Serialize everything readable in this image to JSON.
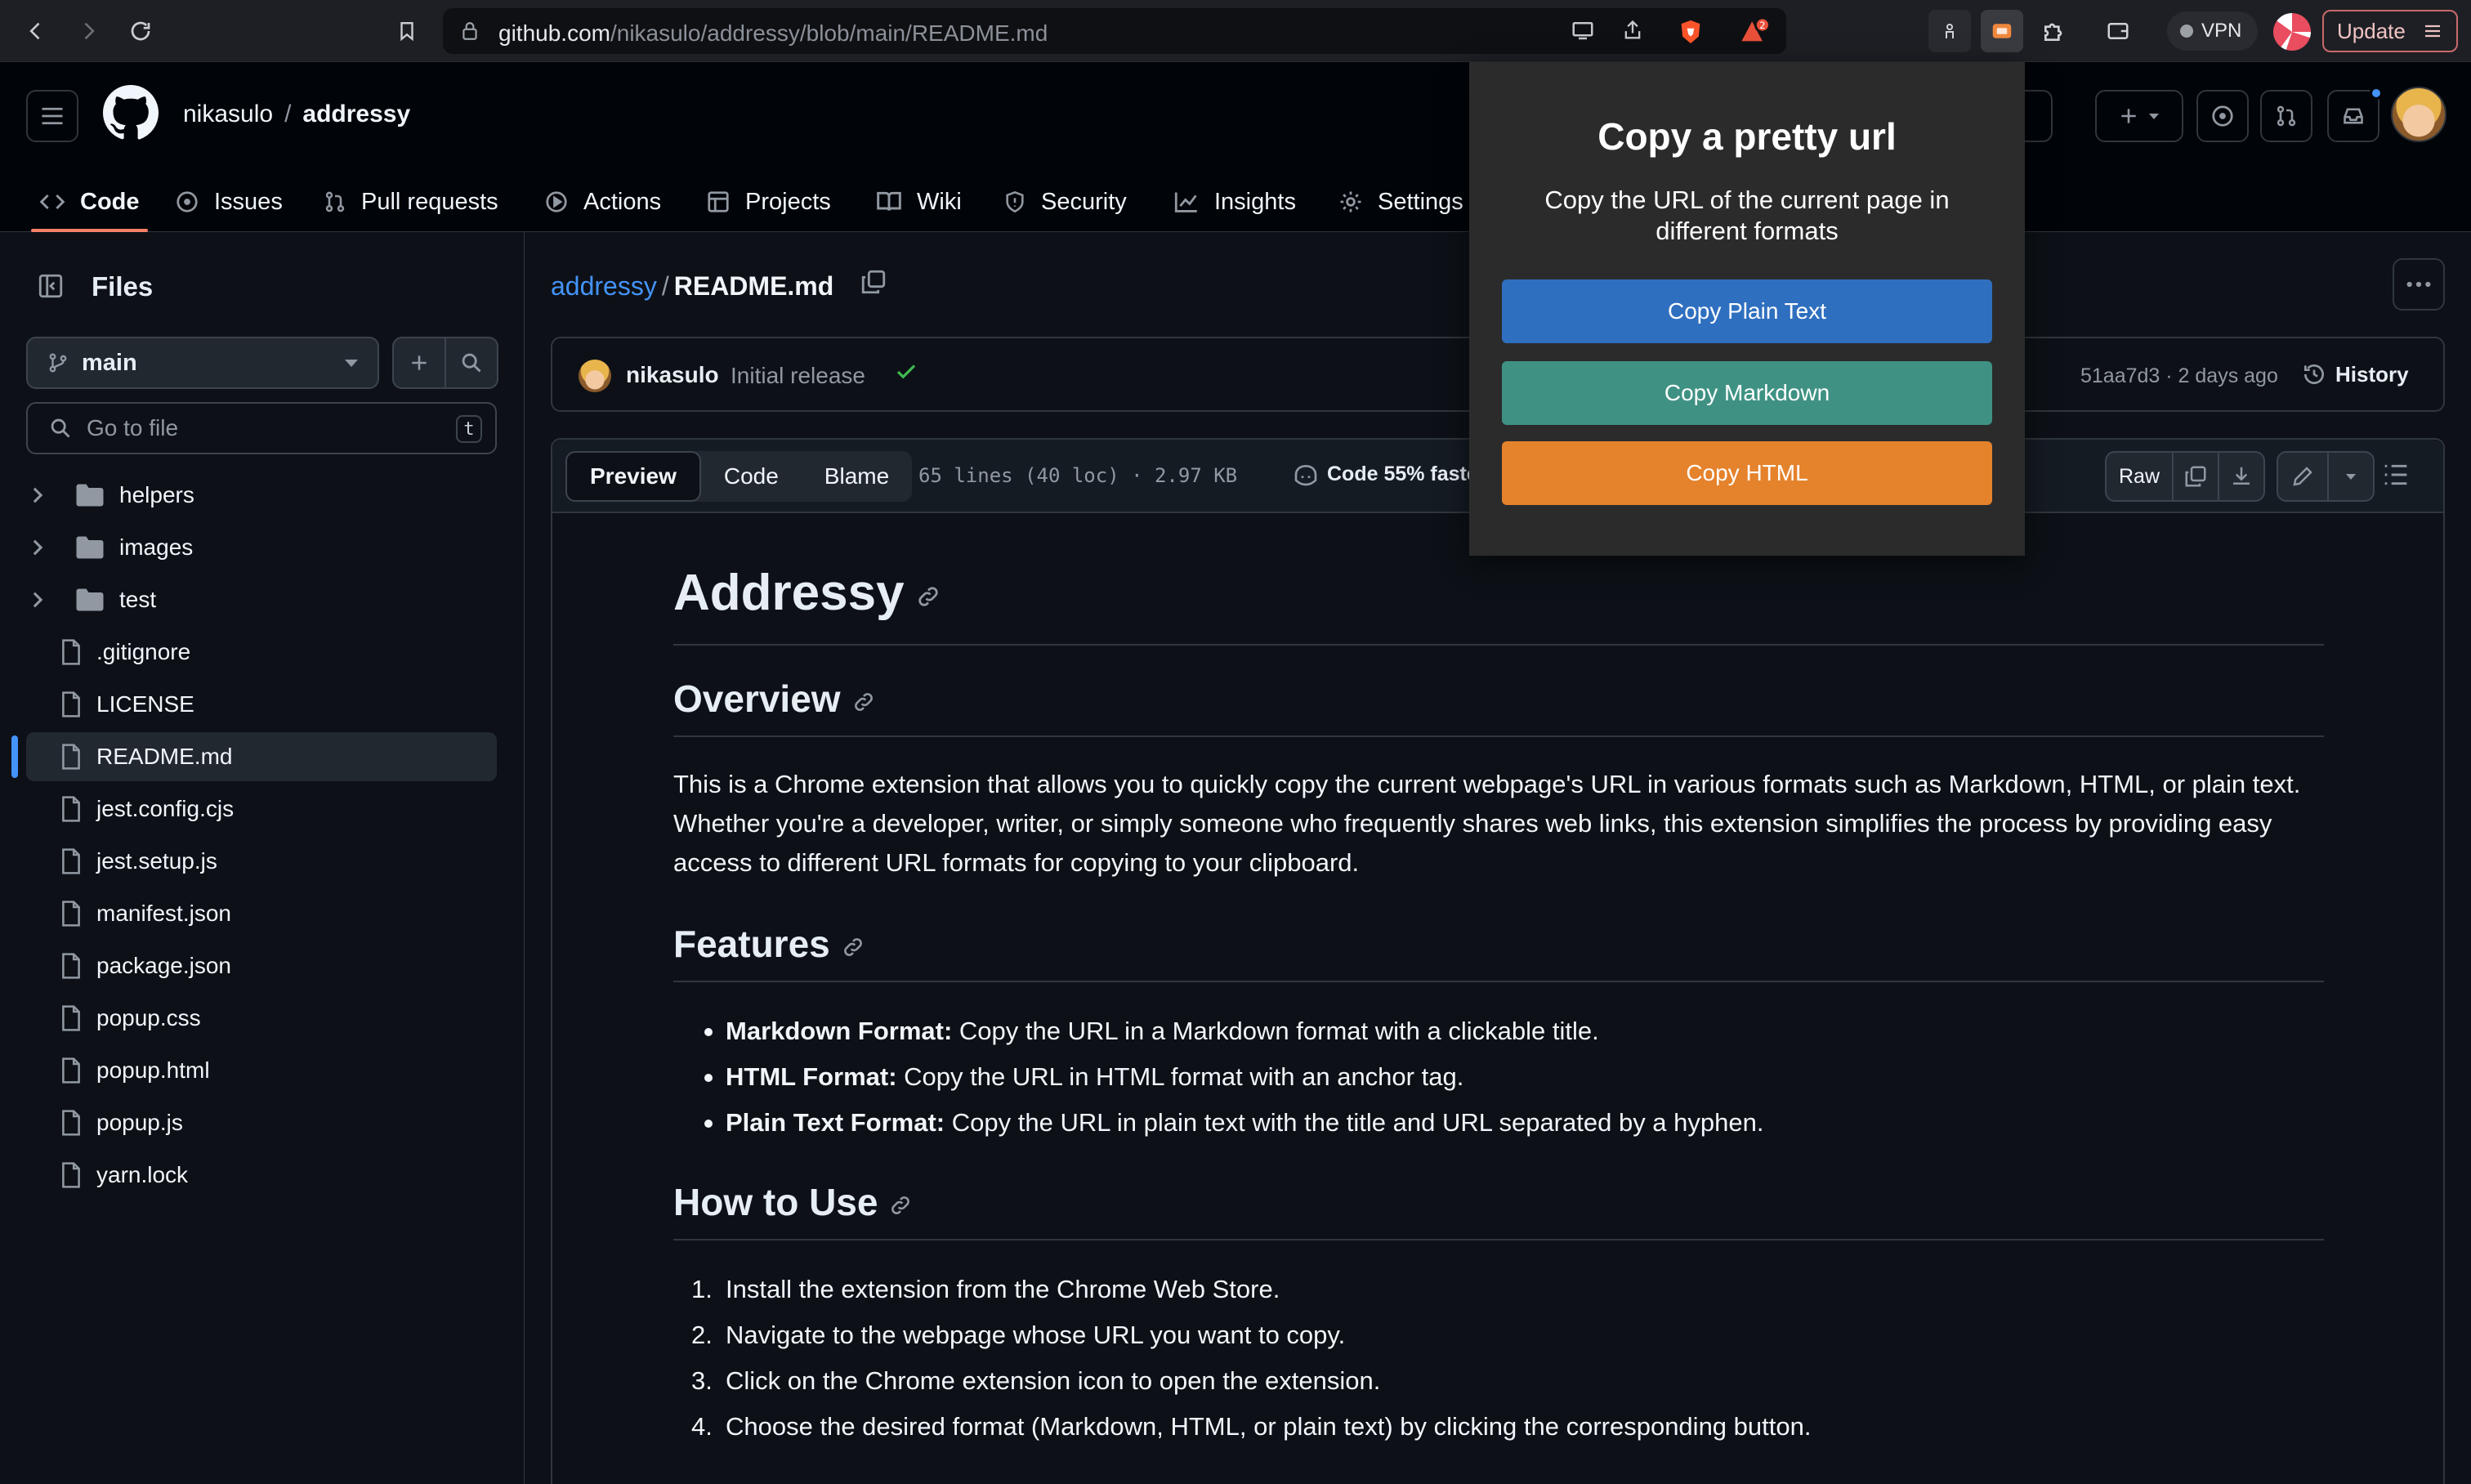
{
  "browser": {
    "url_host": "github.com",
    "url_path": "/nikasulo/addressy/blob/main/README.md",
    "vpn_label": "VPN",
    "update_label": "Update",
    "shields_badge": "2"
  },
  "header": {
    "owner": "nikasulo",
    "separator": "/",
    "repo": "addressy"
  },
  "tabs": [
    {
      "label": "Code",
      "icon": "code-icon"
    },
    {
      "label": "Issues",
      "icon": "issue-icon"
    },
    {
      "label": "Pull requests",
      "icon": "pull-request-icon"
    },
    {
      "label": "Actions",
      "icon": "play-icon"
    },
    {
      "label": "Projects",
      "icon": "table-icon"
    },
    {
      "label": "Wiki",
      "icon": "book-icon"
    },
    {
      "label": "Security",
      "icon": "shield-icon"
    },
    {
      "label": "Insights",
      "icon": "graph-icon"
    },
    {
      "label": "Settings",
      "icon": "gear-icon"
    }
  ],
  "sidebar": {
    "title": "Files",
    "branch": "main",
    "search_placeholder": "Go to file",
    "search_shortcut": "t",
    "items": [
      {
        "name": "helpers",
        "type": "folder"
      },
      {
        "name": "images",
        "type": "folder"
      },
      {
        "name": "test",
        "type": "folder"
      },
      {
        "name": ".gitignore",
        "type": "file"
      },
      {
        "name": "LICENSE",
        "type": "file"
      },
      {
        "name": "README.md",
        "type": "file",
        "selected": true
      },
      {
        "name": "jest.config.cjs",
        "type": "file"
      },
      {
        "name": "jest.setup.js",
        "type": "file"
      },
      {
        "name": "manifest.json",
        "type": "file"
      },
      {
        "name": "package.json",
        "type": "file"
      },
      {
        "name": "popup.css",
        "type": "file"
      },
      {
        "name": "popup.html",
        "type": "file"
      },
      {
        "name": "popup.js",
        "type": "file"
      },
      {
        "name": "yarn.lock",
        "type": "file"
      }
    ]
  },
  "file": {
    "repo_link": "addressy",
    "sep": "/",
    "name": "README.md"
  },
  "commit": {
    "user": "nikasulo",
    "message": "Initial release",
    "hash_time": "51aa7d3 · 2 days ago",
    "history_label": "History"
  },
  "filebar": {
    "preview": "Preview",
    "code": "Code",
    "blame": "Blame",
    "meta": "65 lines (40 loc) · 2.97 KB",
    "copilot": "Code 55% faste",
    "raw": "Raw"
  },
  "readme": {
    "title": "Addressy",
    "overview_heading": "Overview",
    "overview_text": "This is a Chrome extension that allows you to quickly copy the current webpage's URL in various formats such as Markdown, HTML, or plain text. Whether you're a developer, writer, or simply someone who frequently shares web links, this extension simplifies the process by providing easy access to different URL formats for copying to your clipboard.",
    "features_heading": "Features",
    "features": [
      {
        "bold": "Markdown Format:",
        "text": " Copy the URL in a Markdown format with a clickable title."
      },
      {
        "bold": "HTML Format:",
        "text": " Copy the URL in HTML format with an anchor tag."
      },
      {
        "bold": "Plain Text Format:",
        "text": " Copy the URL in plain text with the title and URL separated by a hyphen."
      }
    ],
    "howto_heading": "How to Use",
    "steps": [
      {
        "num": "1.",
        "text": "Install the extension from the Chrome Web Store."
      },
      {
        "num": "2.",
        "text": "Navigate to the webpage whose URL you want to copy."
      },
      {
        "num": "3.",
        "text": "Click on the Chrome extension icon to open the extension."
      },
      {
        "num": "4.",
        "text": "Choose the desired format (Markdown, HTML, or plain text) by clicking the corresponding button."
      }
    ]
  },
  "popup": {
    "title": "Copy a pretty url",
    "description": "Copy the URL of the current page in different formats",
    "buttons": [
      {
        "label": "Copy Plain Text",
        "color": "#2f6fbf"
      },
      {
        "label": "Copy Markdown",
        "color": "#3f9283"
      },
      {
        "label": "Copy HTML",
        "color": "#e5822c"
      }
    ]
  },
  "colors": {
    "accent_link": "#4493f8",
    "tab_underline": "#f78166",
    "success": "#3fb950"
  }
}
